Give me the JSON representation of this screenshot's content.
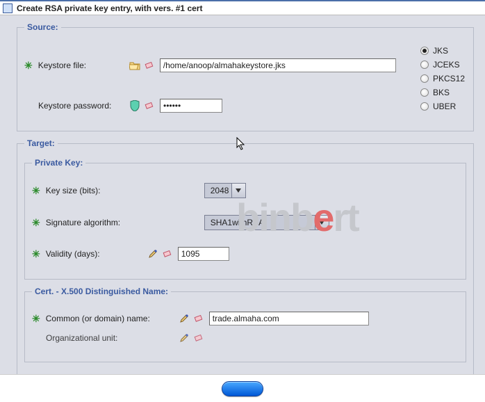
{
  "window": {
    "title": "Create RSA private key entry, with vers. #1 cert"
  },
  "source": {
    "legend": "Source:",
    "keystore_file_label": "Keystore file:",
    "keystore_file_value": "/home/anoop/almahakeystore.jks",
    "keystore_password_label": "Keystore password:",
    "keystore_password_value": "••••••",
    "formats": [
      {
        "label": "JKS",
        "selected": true
      },
      {
        "label": "JCEKS",
        "selected": false
      },
      {
        "label": "PKCS12",
        "selected": false
      },
      {
        "label": "BKS",
        "selected": false
      },
      {
        "label": "UBER",
        "selected": false
      }
    ]
  },
  "target": {
    "legend": "Target:",
    "private_key": {
      "legend": "Private Key:",
      "key_size_label": "Key size (bits):",
      "key_size_value": "2048",
      "sig_algo_label": "Signature algorithm:",
      "sig_algo_value": "SHA1withRSA",
      "validity_label": "Validity (days):",
      "validity_value": "1095"
    },
    "cert_dn": {
      "legend": "Cert. - X.500 Distinguished Name:",
      "cn_label": "Common (or domain) name:",
      "cn_value": "trade.almaha.com",
      "ou_label": "Organizational unit:"
    }
  },
  "watermark": {
    "pre": "binb",
    "e": "e",
    "post": "rt"
  }
}
